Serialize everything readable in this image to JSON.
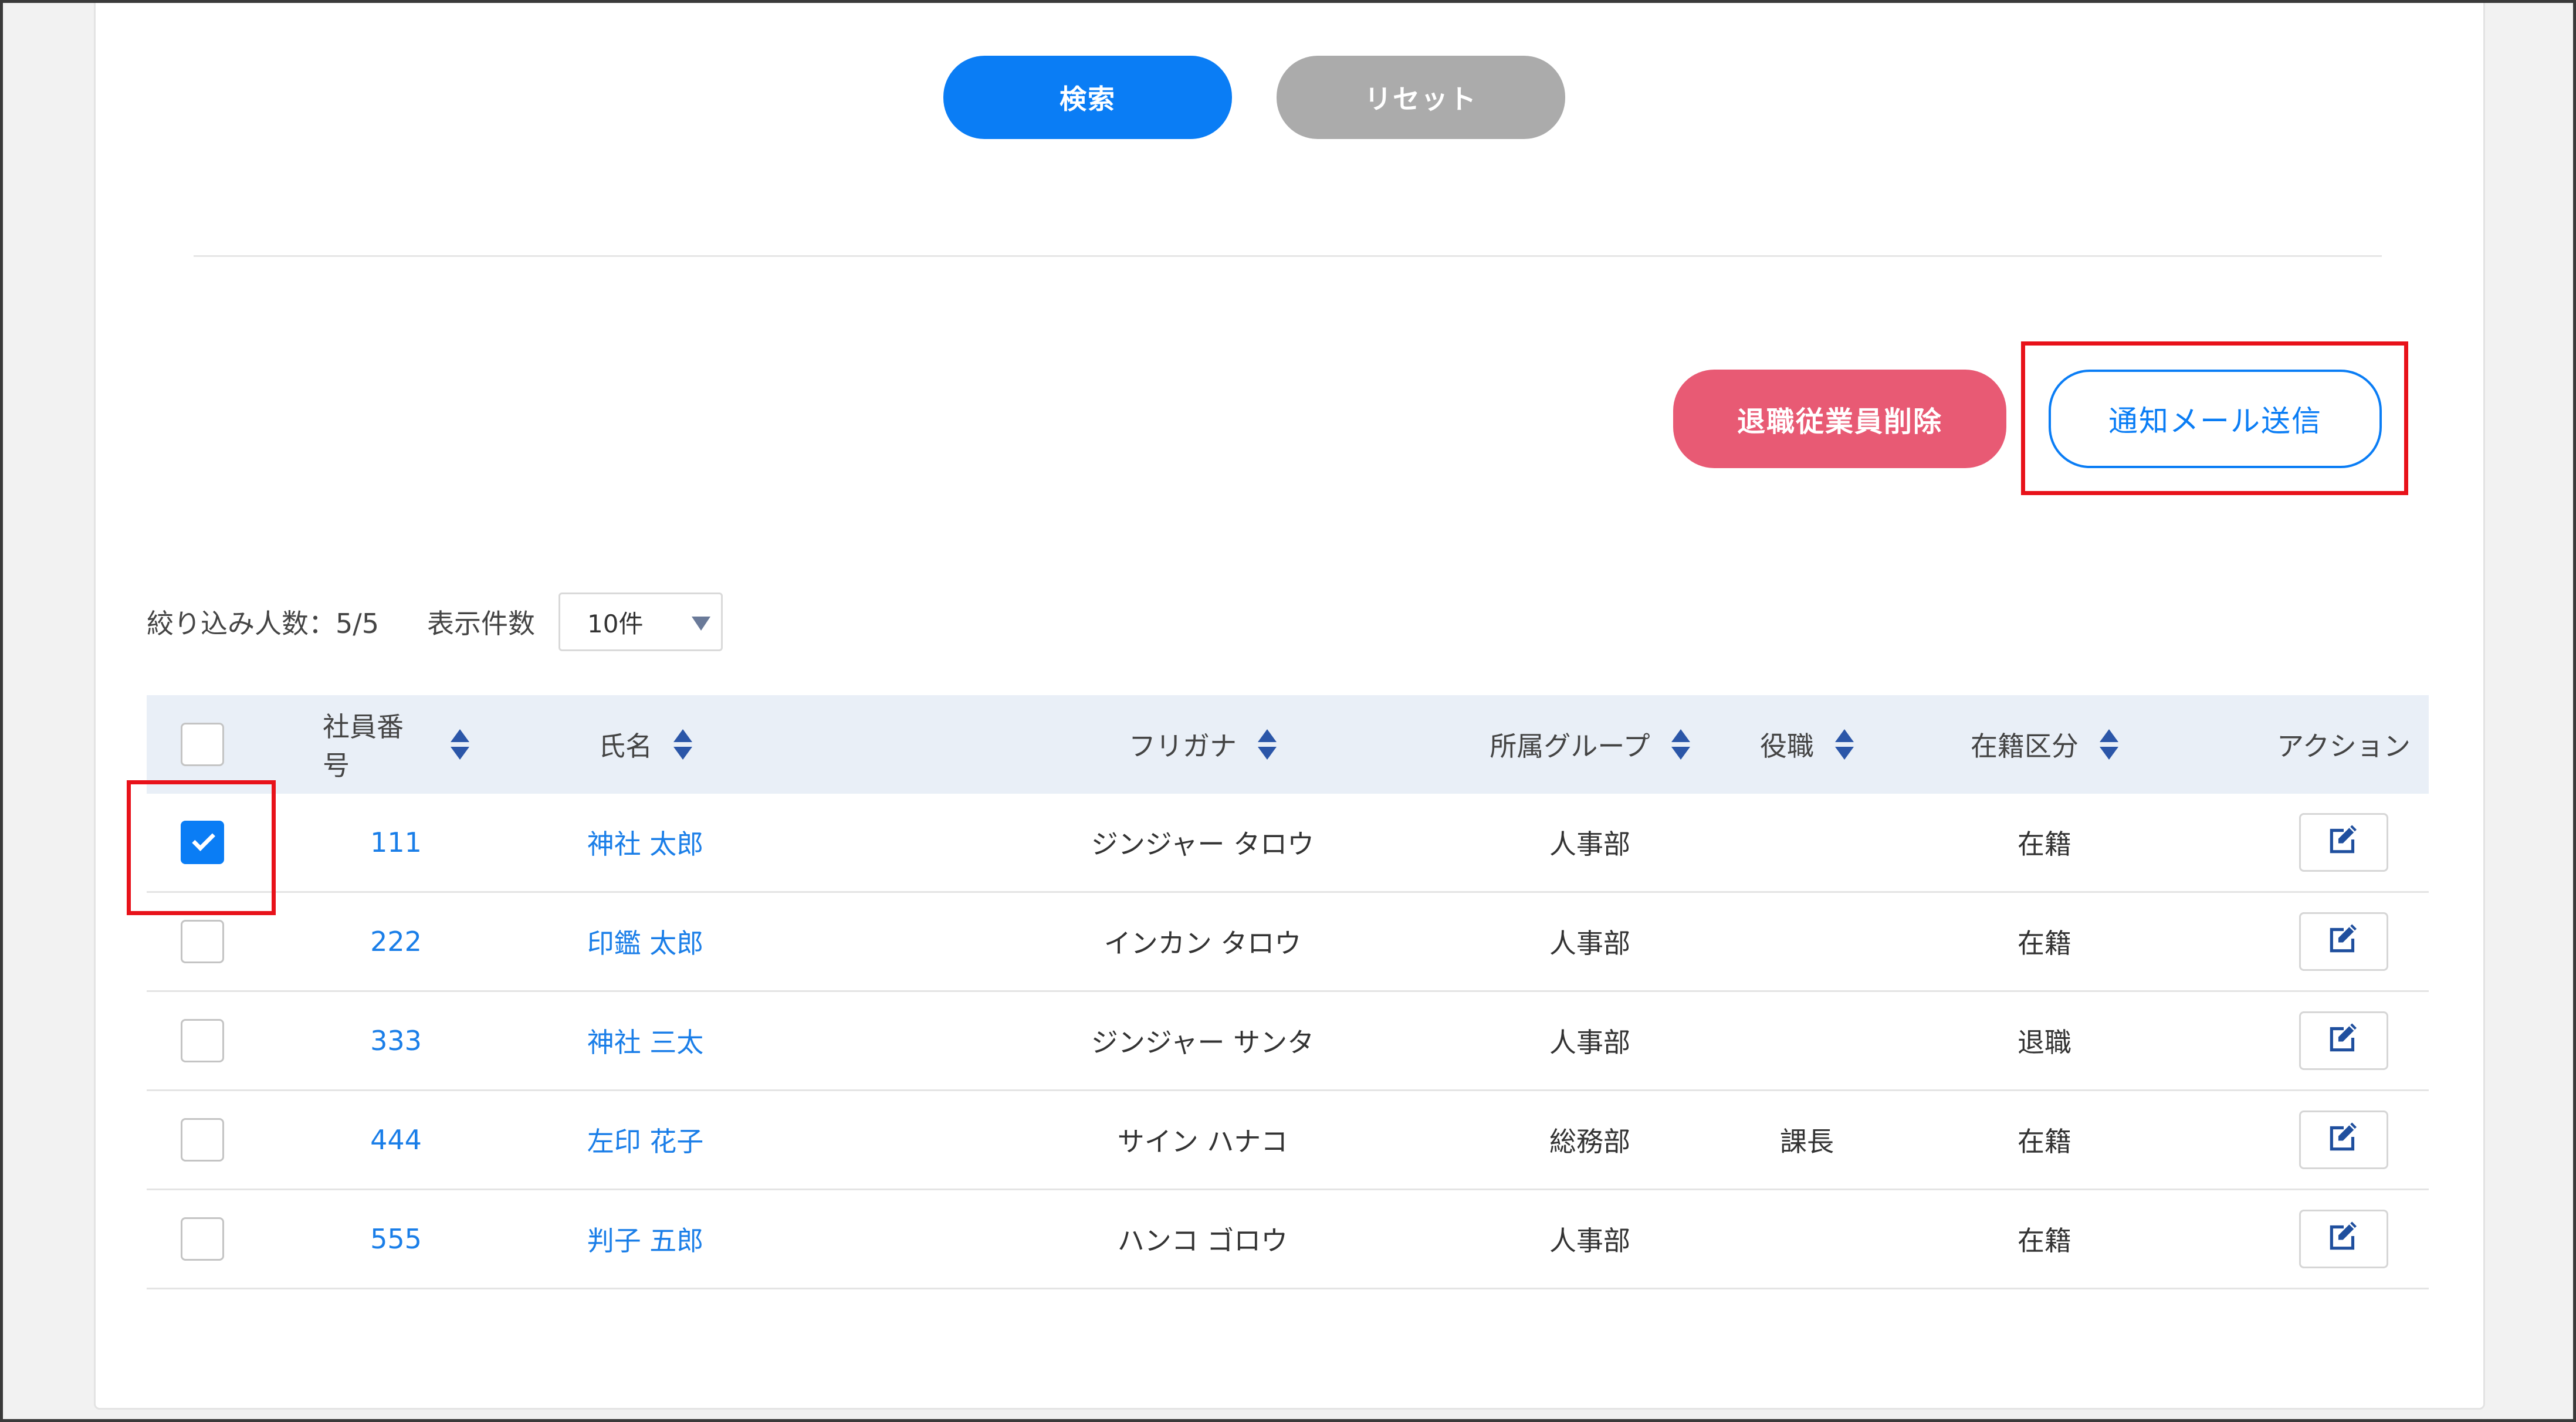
{
  "search": {
    "search_label": "検索",
    "reset_label": "リセット"
  },
  "actions": {
    "delete_label": "退職従業員削除",
    "notify_label": "通知メール送信"
  },
  "filter": {
    "count_text": "絞り込み人数：5/5",
    "page_size_label": "表示件数",
    "page_size_value": "10件"
  },
  "table": {
    "headers": {
      "employee_id": "社員番号",
      "name": "氏名",
      "kana": "フリガナ",
      "group": "所属グループ",
      "role": "役職",
      "status": "在籍区分",
      "action": "アクション"
    },
    "rows": [
      {
        "checked": true,
        "id": "111",
        "name": "神社 太郎",
        "kana": "ジンジャー タロウ",
        "group": "人事部",
        "role": "",
        "status": "在籍"
      },
      {
        "checked": false,
        "id": "222",
        "name": "印鑑 太郎",
        "kana": "インカン タロウ",
        "group": "人事部",
        "role": "",
        "status": "在籍"
      },
      {
        "checked": false,
        "id": "333",
        "name": "神社 三太",
        "kana": "ジンジャー サンタ",
        "group": "人事部",
        "role": "",
        "status": "退職"
      },
      {
        "checked": false,
        "id": "444",
        "name": "左印 花子",
        "kana": "サイン ハナコ",
        "group": "総務部",
        "role": "課長",
        "status": "在籍"
      },
      {
        "checked": false,
        "id": "555",
        "name": "判子 五郎",
        "kana": "ハンコ ゴロウ",
        "group": "人事部",
        "role": "",
        "status": "在籍"
      }
    ]
  },
  "colors": {
    "primary": "#0a7df5",
    "danger": "#e85a74",
    "reset": "#ababab",
    "highlight": "#e8121a",
    "header_bg": "#e9eff7"
  },
  "icons": {
    "sort": "sort-icon",
    "edit": "edit-icon",
    "dropdown": "chevron-down-icon",
    "check": "check-icon"
  }
}
